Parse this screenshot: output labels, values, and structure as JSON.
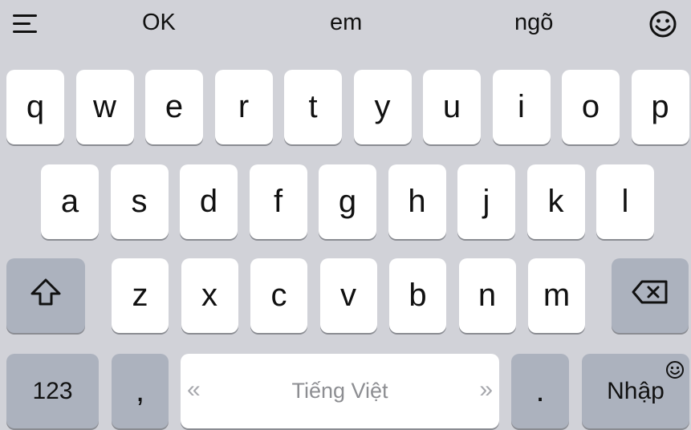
{
  "suggestions": {
    "menu_icon": "menu-lines-icon",
    "words": [
      "OK",
      "em",
      "ngõ"
    ],
    "emoji_icon": "smiley-face-icon"
  },
  "rows": {
    "row1": [
      "q",
      "w",
      "e",
      "r",
      "t",
      "y",
      "u",
      "i",
      "o",
      "p"
    ],
    "row2": [
      "a",
      "s",
      "d",
      "f",
      "g",
      "h",
      "j",
      "k",
      "l"
    ],
    "row3": [
      "z",
      "x",
      "c",
      "v",
      "b",
      "n",
      "m"
    ]
  },
  "keys": {
    "shift_icon": "shift-arrow-icon",
    "backspace_icon": "backspace-icon",
    "numbers": "123",
    "comma": ",",
    "space": "Tiếng Việt",
    "space_left": "«",
    "space_right": "»",
    "period": ".",
    "enter": "Nhập",
    "enter_emoji_icon": "smiley-face-icon"
  },
  "colors": {
    "background": "#d1d2d8",
    "key": "#ffffff",
    "function_key": "#acb2be",
    "text": "#111111"
  }
}
